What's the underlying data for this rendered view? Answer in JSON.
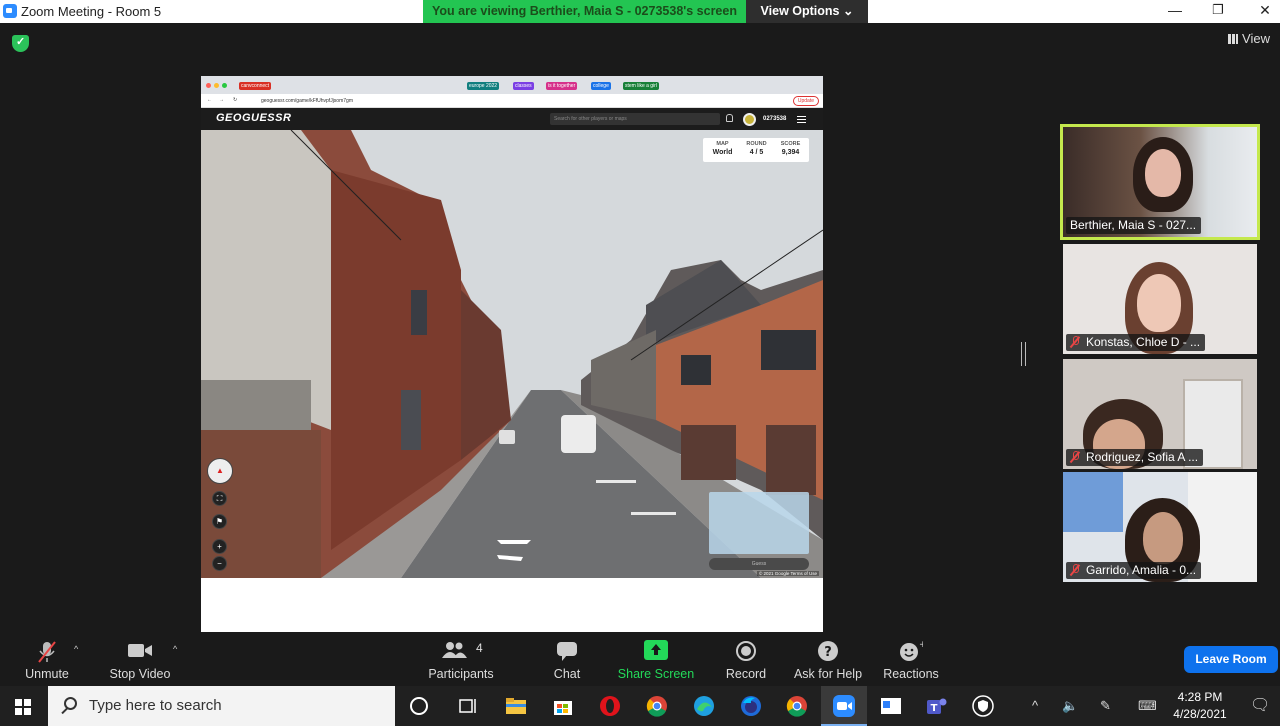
{
  "window": {
    "title": "Zoom Meeting - Room 5"
  },
  "banner": {
    "viewing_text": "You are viewing Berthier, Maia S - 0273538's screen",
    "view_options": "View Options ⌄"
  },
  "top_right": {
    "view_label": "View"
  },
  "shared_screen": {
    "bookmarks": [
      "canvconnect",
      "europe 2022",
      "classes",
      "is it together",
      "college",
      "stem like a girl"
    ],
    "url": "geoguessr.com/game/kFfUhvpfJjsom7gm",
    "update_label": "Update",
    "geoguessr": {
      "logo": "GEOGUESSR",
      "search_placeholder": "Search for other players or maps",
      "username": "0273538",
      "stats": {
        "map_label": "MAP",
        "map_value": "World",
        "round_label": "ROUND",
        "round_value": "4 / 5",
        "score_label": "SCORE",
        "score_value": "9,394"
      },
      "guess_label": "Guess",
      "copyright": "© 2021 Google   Terms of Use"
    }
  },
  "participants": [
    {
      "name": "Berthier, Maia S - 027...",
      "muted": false,
      "active": true
    },
    {
      "name": "Konstas, Chloe D - ...",
      "muted": true,
      "active": false
    },
    {
      "name": "Rodriguez, Sofia A ...",
      "muted": true,
      "active": false
    },
    {
      "name": "Garrido, Amalia - 0...",
      "muted": true,
      "active": false
    }
  ],
  "toolbar": {
    "unmute": "Unmute",
    "stop_video": "Stop Video",
    "participants": "Participants",
    "participants_count": "4",
    "chat": "Chat",
    "share_screen": "Share Screen",
    "record": "Record",
    "ask_for_help": "Ask for Help",
    "reactions": "Reactions",
    "leave_room": "Leave Room"
  },
  "taskbar": {
    "search_placeholder": "Type here to search",
    "time": "4:28 PM",
    "date": "4/28/2021"
  },
  "colors": {
    "banner_green": "#23c552",
    "leave_blue": "#0e72ed",
    "active_border": "#c4e84d",
    "share_green": "#23d959"
  }
}
